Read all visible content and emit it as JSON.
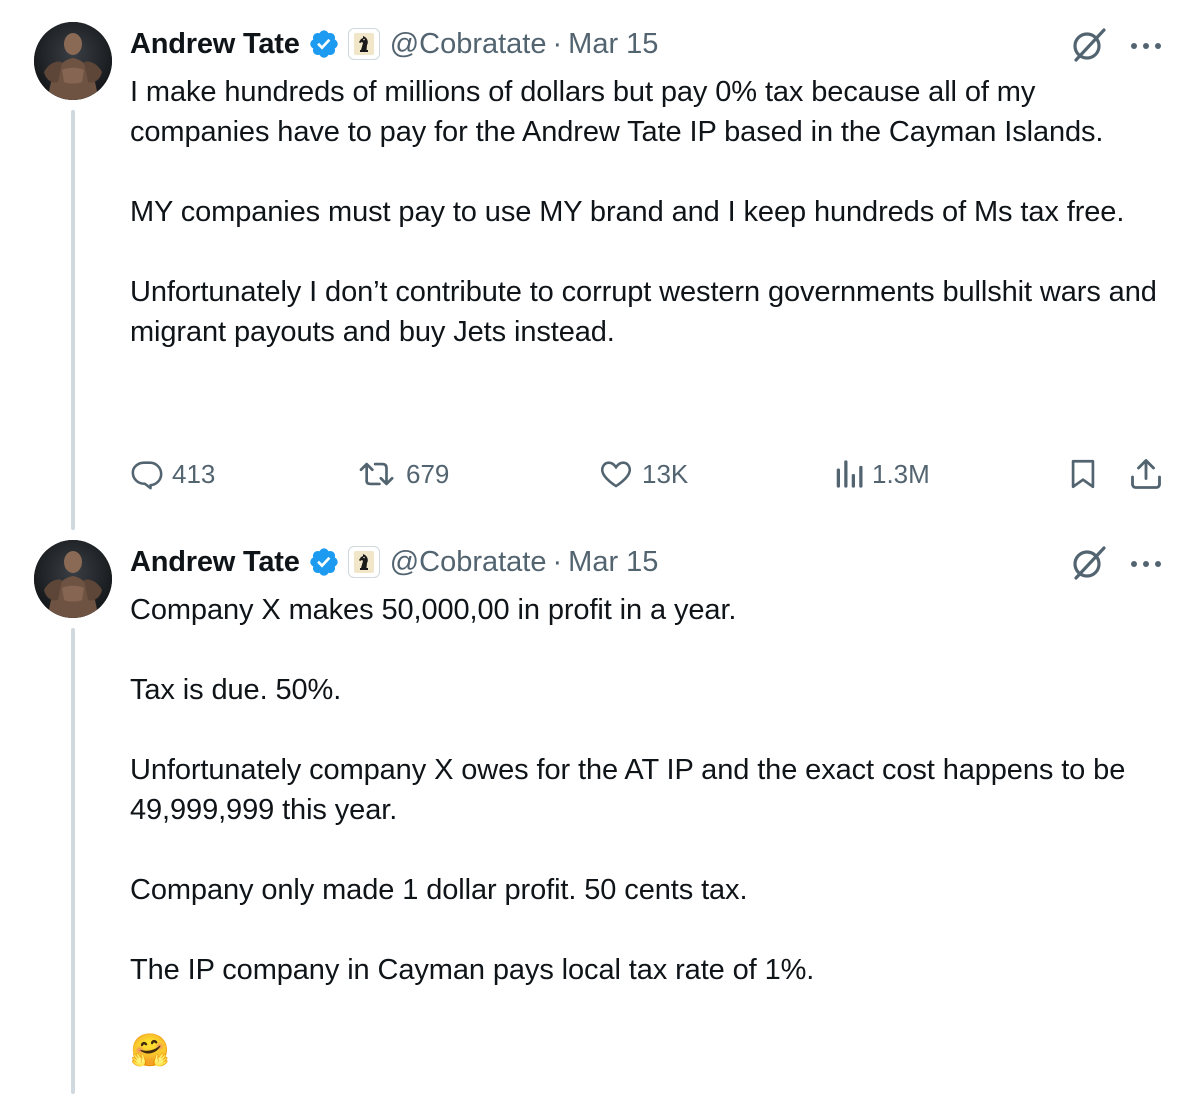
{
  "tweets": [
    {
      "author": {
        "name": "Andrew Tate",
        "handle": "@Cobratate",
        "verified_color": "#1d9bf0",
        "avatar_icon": "avatar-photo",
        "affiliate_icon": "chess-knight-icon"
      },
      "separator": "·",
      "date": "Mar 15",
      "paragraphs": [
        "I make hundreds of millions of dollars but pay 0% tax because all of my companies have to pay for the Andrew Tate IP based in the Cayman Islands.",
        "MY companies must pay to use MY brand and I keep hundreds of Ms tax free.",
        "Unfortunately I don’t contribute to corrupt western governments bullshit wars and migrant payouts and buy Jets instead."
      ],
      "stats": {
        "replies": "413",
        "retweets": "679",
        "likes": "13K",
        "views": "1.3M"
      }
    },
    {
      "author": {
        "name": "Andrew Tate",
        "handle": "@Cobratate",
        "verified_color": "#1d9bf0",
        "avatar_icon": "avatar-photo",
        "affiliate_icon": "chess-knight-icon"
      },
      "separator": "·",
      "date": "Mar 15",
      "paragraphs": [
        "Company X makes 50,000,00 in profit in a year.",
        "Tax is due. 50%.",
        "Unfortunately company X owes for the AT IP and the exact cost happens to be 49,999,999 this year.",
        "Company only made 1 dollar profit. 50 cents tax.",
        "The IP company in Cayman pays local tax rate of 1%."
      ],
      "emoji": "🤗"
    }
  ],
  "colors": {
    "text": "#0f1419",
    "secondary": "#536471",
    "thread_line": "#cfd9de",
    "verified": "#1d9bf0"
  }
}
